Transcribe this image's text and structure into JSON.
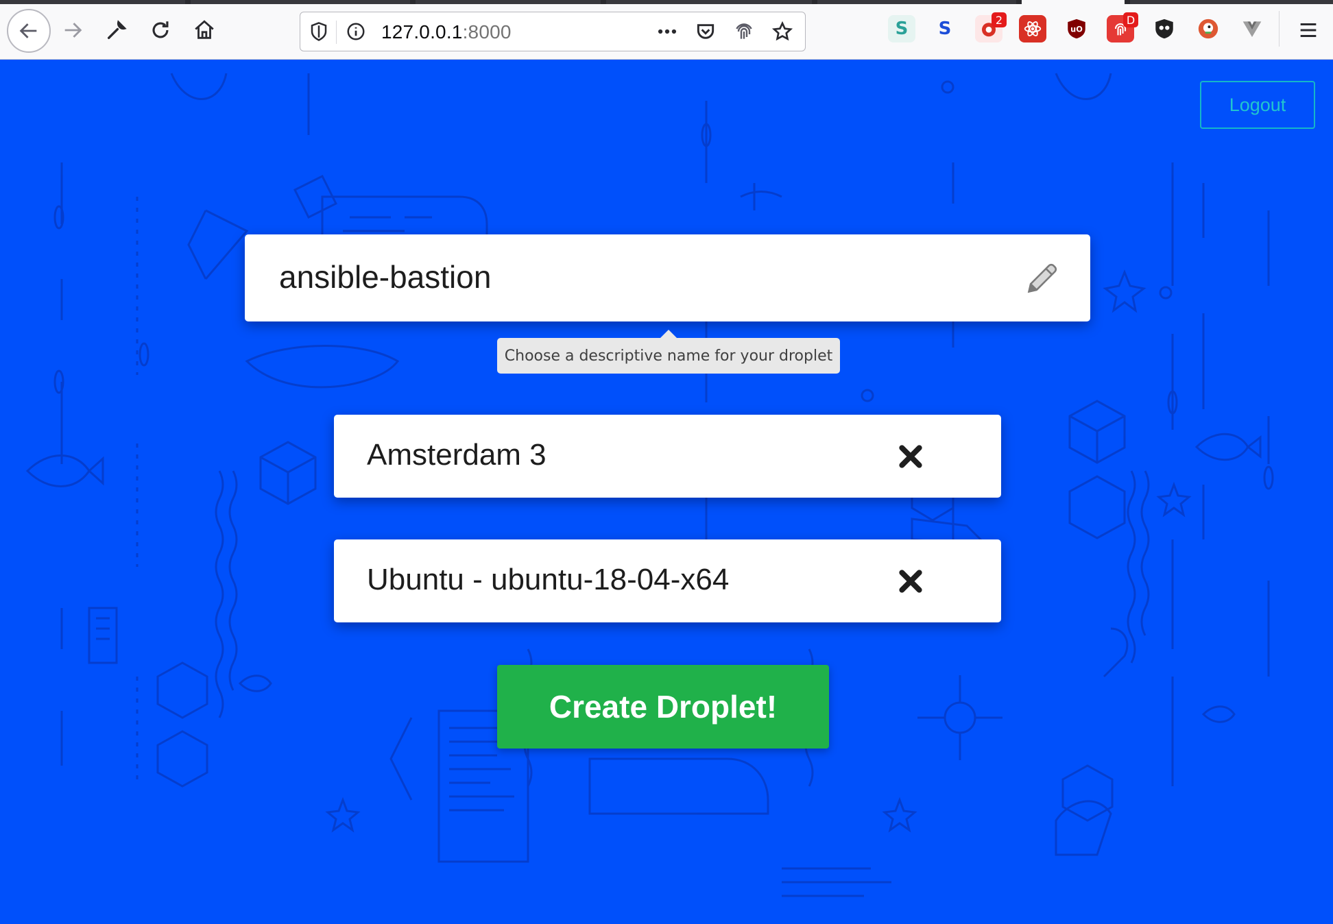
{
  "browser": {
    "url_host": "127.0.0.1",
    "url_port": ":8000",
    "toolbar_icons": [
      "back-icon",
      "forward-icon",
      "wrench-icon",
      "reload-icon",
      "home-icon"
    ],
    "urlbar_icons": [
      "shield-icon",
      "info-icon",
      "more-icon",
      "pocket-icon",
      "fingerprint-icon",
      "star-icon"
    ],
    "extensions": [
      {
        "name": "s-extension-icon",
        "glyph": "S",
        "color": "#2aa198"
      },
      {
        "name": "s-blue-extension-icon",
        "glyph": "S",
        "color": "#1d4ed8"
      },
      {
        "name": "red-extension-icon",
        "glyph": "",
        "color": "#d93025",
        "badge": "2"
      },
      {
        "name": "react-devtools-icon",
        "glyph": "",
        "color": "#d93025"
      },
      {
        "name": "ublock-icon",
        "glyph": "uo",
        "color": "#800000"
      },
      {
        "name": "fingerprint-extension-icon",
        "glyph": "",
        "color": "#e53935",
        "badge": "D"
      },
      {
        "name": "privacy-badger-icon",
        "glyph": "",
        "color": "#333333"
      },
      {
        "name": "duckduckgo-icon",
        "glyph": "",
        "color": "#de5833"
      },
      {
        "name": "vue-devtools-icon",
        "glyph": "V",
        "color": "#9e9e9e"
      }
    ],
    "menu_icon": "hamburger-menu-icon"
  },
  "header": {
    "logout_label": "Logout"
  },
  "form": {
    "droplet_name": "ansible-bastion",
    "name_hint": "Choose a descriptive name for your droplet",
    "region": "Amsterdam 3",
    "image": "Ubuntu - ubuntu-18-04-x64",
    "submit_label": "Create Droplet!"
  },
  "colors": {
    "background": "#0050fb",
    "logout_accent": "#21c4cf",
    "create_button": "#20b14a"
  }
}
